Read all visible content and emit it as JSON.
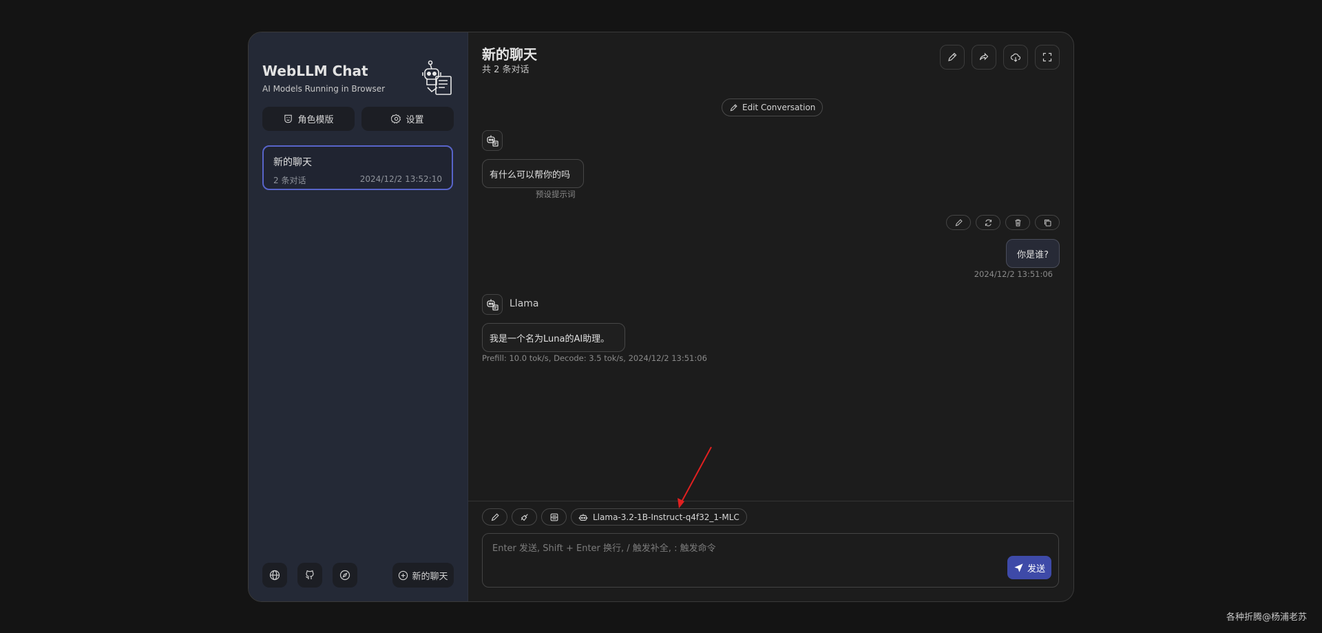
{
  "sidebar": {
    "title": "WebLLM Chat",
    "subtitle": "AI Models Running in Browser",
    "buttons": {
      "roles": "角色模版",
      "settings": "设置"
    },
    "chats": [
      {
        "title": "新的聊天",
        "count": "2 条对话",
        "time": "2024/12/2 13:52:10"
      }
    ],
    "new_chat": "新的聊天"
  },
  "main": {
    "title": "新的聊天",
    "subtitle": "共 2 条对话",
    "edit_conversation": "Edit Conversation",
    "messages": [
      {
        "role": "assistant",
        "text": "有什么可以帮你的吗",
        "meta": "预设提示词"
      },
      {
        "role": "user",
        "text": "你是谁?",
        "meta": "2024/12/2 13:51:06"
      },
      {
        "role": "assistant",
        "name": "Llama",
        "text": "我是一个名为Luna的AI助理。",
        "meta": "Prefill: 10.0 tok/s,  Decode: 3.5 tok/s,  2024/12/2 13:51:06"
      }
    ],
    "model": "Llama-3.2-1B-Instruct-q4f32_1-MLC",
    "input_placeholder": "Enter 发送, Shift + Enter 换行, / 触发补全, : 触发命令",
    "send": "发送"
  },
  "watermark": "各种折腾@杨浦老苏",
  "colors": {
    "accent": "#3e4aa8",
    "selected_border": "#5864c9",
    "arrow": "#e02020"
  }
}
